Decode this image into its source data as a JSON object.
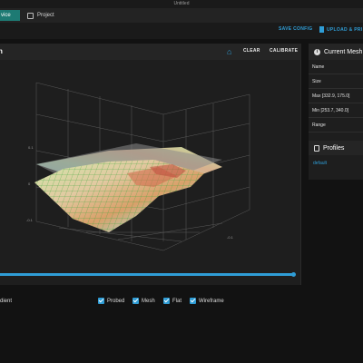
{
  "window": {
    "title": "Untitled"
  },
  "tabs": [
    {
      "label": "vice"
    },
    {
      "label": "Project"
    }
  ],
  "toolbar": {
    "save_config": "SAVE CONFIG",
    "upload": "UPLOAD & PRI"
  },
  "mesh_panel": {
    "title": "n",
    "clear": "CLEAR",
    "calibrate": "CALIBRATE",
    "legend": {
      "gradient_label": "dient",
      "checkboxes": [
        {
          "label": "Probed",
          "checked": true
        },
        {
          "label": "Mesh",
          "checked": true
        },
        {
          "label": "Flat",
          "checked": true
        },
        {
          "label": "Wireframe",
          "checked": true
        }
      ]
    },
    "slider_value": 1.0,
    "axis_labels": {
      "z": [
        "0.1",
        "0",
        "-0.1"
      ],
      "x": [
        "100"
      ],
      "y": [
        "300",
        "200",
        "100"
      ],
      "extra": [
        "-0.1"
      ]
    }
  },
  "current_mesh": {
    "title": "Current Mesh",
    "rows": [
      {
        "label": "Name"
      },
      {
        "label": "Size"
      },
      {
        "label": "Max [332.9, 175.0]"
      },
      {
        "label": "Min [253.7, 340.0]"
      },
      {
        "label": "Range"
      }
    ]
  },
  "profiles": {
    "title": "Profiles",
    "items": [
      "default"
    ]
  },
  "colors": {
    "accent": "#2f9dd6",
    "tab_active": "#1d7a73",
    "bg": "#121212"
  }
}
